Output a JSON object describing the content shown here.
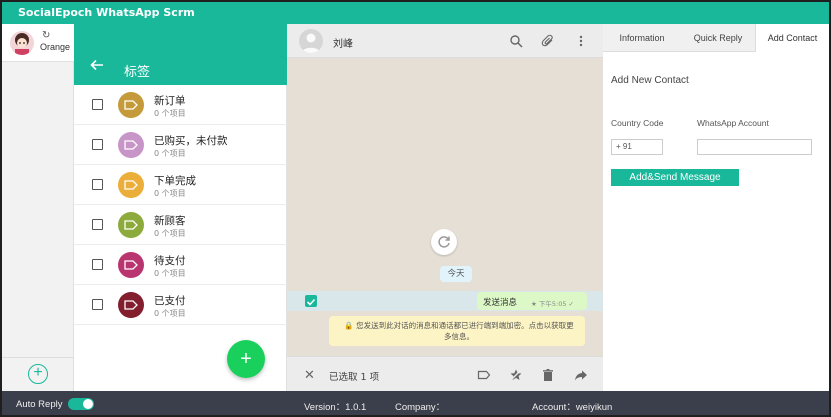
{
  "app": {
    "title": "SocialEpoch WhatsApp Scrm"
  },
  "sidebar": {
    "account_name": "Orange",
    "refresh_symbol": "↻",
    "add_symbol": "+"
  },
  "label_panel": {
    "title": "标签",
    "items": [
      {
        "name": "新订单",
        "count": "0 个项目",
        "color": "#c49a3a"
      },
      {
        "name": "已购买，未付款",
        "count": "0 个项目",
        "color": "#c895c8"
      },
      {
        "name": "下单完成",
        "count": "0 个项目",
        "color": "#ebae3a"
      },
      {
        "name": "新顾客",
        "count": "0 个项目",
        "color": "#8daa3c"
      },
      {
        "name": "待支付",
        "count": "0 个项目",
        "color": "#b83570"
      },
      {
        "name": "已支付",
        "count": "0 个项目",
        "color": "#821e2e"
      }
    ],
    "fab_symbol": "+"
  },
  "chat": {
    "contact_name": "刘峰",
    "date_chip": "今天",
    "message_text": "发送消息",
    "message_time": "★ 下午5:05 ✓",
    "notice": "🔒 您发送到此对话的消息和通话都已进行端到端加密。点击以获取更多信息。",
    "selected_text": "已选取 1 项",
    "close_symbol": "✕"
  },
  "right_panel": {
    "tabs": [
      "Information",
      "Quick Reply",
      "Add Contact"
    ],
    "active_tab": "Add Contact",
    "section_title": "Add New Contact",
    "country_code_label": "Country Code",
    "whatsapp_label": "WhatsApp Account",
    "country_code_value": "+ 91",
    "whatsapp_value": "",
    "submit_label": "Add&Send Message"
  },
  "status_bar": {
    "auto_reply_label": "Auto Reply",
    "auto_reply_on": true,
    "version": "Version：1.0.1",
    "company": "Company：",
    "account": "Account：weiyikun"
  },
  "colors": {
    "accent": "#19b89b",
    "fab": "#1ad05c",
    "statusbar": "#3a3f4b"
  }
}
